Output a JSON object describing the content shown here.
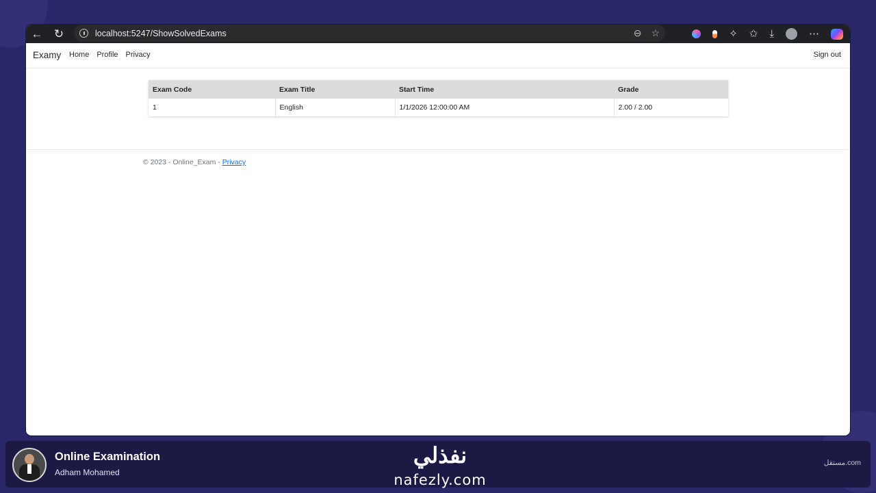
{
  "browser": {
    "url": "localhost:5247/ShowSolvedExams"
  },
  "site": {
    "brand": "Examy",
    "nav": [
      "Home",
      "Profile",
      "Privacy"
    ],
    "sign_out": "Sign out"
  },
  "table": {
    "headers": [
      "Exam Code",
      "Exam Title",
      "Start Time",
      "Grade"
    ],
    "rows": [
      [
        "1",
        "English",
        "1/1/2026 12:00:00 AM",
        "2.00 / 2.00"
      ]
    ]
  },
  "footer": {
    "text": "© 2023 - Online_Exam - ",
    "link": "Privacy"
  },
  "banner": {
    "title": "Online Examination",
    "author": "Adham Mohamed",
    "logo_ar": "نفذلي",
    "logo_en": "nafezly.com",
    "mostaql": "مستقل.com"
  },
  "colors": {
    "background": "#2a2768",
    "banner": "#1c1a44",
    "table_header": "#dcdcdc",
    "link": "#0d6efd"
  }
}
